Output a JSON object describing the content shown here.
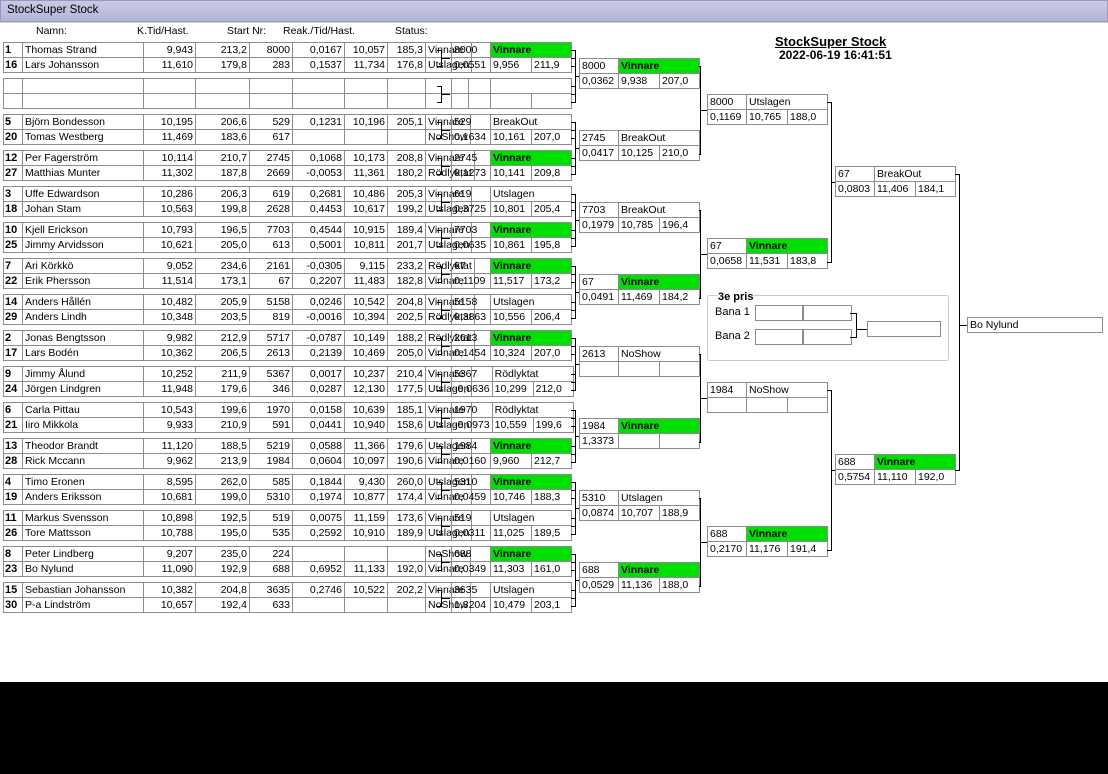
{
  "window": {
    "title": "StockSuper Stock"
  },
  "event": {
    "title": "StockSuper Stock",
    "datetime": "2022-06-19 16:41:51"
  },
  "headers": {
    "name": "Namn:",
    "qualtime": "K.Tid/Hast.",
    "start": "Start Nr:",
    "reak": "Reak./Tid/Hast.",
    "status": "Status:"
  },
  "heats": [
    [
      [
        "1",
        "Thomas Strand",
        "9,943",
        "213,2",
        "8000",
        "0,0167",
        "10,057",
        "185,3",
        "Vinnare"
      ],
      [
        "16",
        "Lars Johansson",
        "11,610",
        "179,8",
        "283",
        "0,1537",
        "11,734",
        "176,8",
        "Utslagen"
      ]
    ],
    [
      [
        "",
        "",
        "",
        "",
        "",
        "",
        "",
        "",
        ""
      ],
      [
        "",
        "",
        "",
        "",
        "",
        "",
        "",
        "",
        ""
      ]
    ],
    [
      [
        "5",
        "Björn Bondesson",
        "10,195",
        "206,6",
        "529",
        "0,1231",
        "10,196",
        "205,1",
        "Vinnare"
      ],
      [
        "20",
        "Tomas Westberg",
        "11,469",
        "183,6",
        "617",
        "",
        "",
        "",
        "NoShow"
      ]
    ],
    [
      [
        "12",
        "Per  Fagerström",
        "10,114",
        "210,7",
        "2745",
        "0,1068",
        "10,173",
        "208,8",
        "Vinnare"
      ],
      [
        "27",
        "Matthias Munter",
        "11,302",
        "187,8",
        "2669",
        "-0,0053",
        "11,361",
        "180,2",
        "Rödlyktat"
      ]
    ],
    [
      [
        "3",
        "Uffe Edwardson",
        "10,286",
        "206,3",
        "619",
        "0,2681",
        "10,486",
        "205,3",
        "Vinnare"
      ],
      [
        "18",
        "Johan Stam",
        "10,563",
        "199,8",
        "2628",
        "0,4453",
        "10,617",
        "199,2",
        "Utslagen"
      ]
    ],
    [
      [
        "10",
        "Kjell Erickson",
        "10,793",
        "196,5",
        "7703",
        "0,4544",
        "10,915",
        "189,4",
        "Vinnare"
      ],
      [
        "25",
        "Jimmy Arvidsson",
        "10,621",
        "205,0",
        "613",
        "0,5001",
        "10,811",
        "201,7",
        "Utslagen"
      ]
    ],
    [
      [
        "7",
        "Ari Körkkö",
        "9,052",
        "234,6",
        "2161",
        "-0,0305",
        "9,115",
        "233,2",
        "Rödlyktat"
      ],
      [
        "22",
        "Erik Phersson",
        "11,514",
        "173,1",
        "67",
        "0,2207",
        "11,483",
        "182,8",
        "Vinnare"
      ]
    ],
    [
      [
        "14",
        "Anders Hållén",
        "10,482",
        "205,9",
        "5158",
        "0,0246",
        "10,542",
        "204,8",
        "Vinnare"
      ],
      [
        "29",
        "Anders Lindh",
        "10,348",
        "203,5",
        "819",
        "-0,0016",
        "10,394",
        "202,5",
        "Rödlyktat"
      ]
    ],
    [
      [
        "2",
        "Jonas Bengtsson",
        "9,982",
        "212,9",
        "5717",
        "-0,0787",
        "10,149",
        "188,2",
        "Rödlyktat"
      ],
      [
        "17",
        "Lars Bodén",
        "10,362",
        "206,5",
        "2613",
        "0,2139",
        "10,469",
        "205,0",
        "Vinnare"
      ]
    ],
    [
      [
        "9",
        "Jimmy Ålund",
        "10,252",
        "211,9",
        "5367",
        "0,0017",
        "10,237",
        "210,4",
        "Vinnare"
      ],
      [
        "24",
        "Jörgen Lindgren",
        "11,948",
        "179,6",
        "346",
        "0,0287",
        "12,130",
        "177,5",
        "Utslagen"
      ]
    ],
    [
      [
        "6",
        "Carla Pittau",
        "10,543",
        "199,6",
        "1970",
        "0,0158",
        "10,639",
        "185,1",
        "Vinnare"
      ],
      [
        "21",
        "Iiro Mikkola",
        "9,933",
        "210,9",
        "591",
        "0,0441",
        "10,940",
        "158,6",
        "Utslagen"
      ]
    ],
    [
      [
        "13",
        "Theodor Brandt",
        "11,120",
        "188,5",
        "5219",
        "0,0588",
        "11,366",
        "179,6",
        "Utslagen"
      ],
      [
        "28",
        "Rick Mccann",
        "9,962",
        "213,9",
        "1984",
        "0,0604",
        "10,097",
        "190,6",
        "Vinnare"
      ]
    ],
    [
      [
        "4",
        "Timo Eronen",
        "8,595",
        "262,0",
        "585",
        "0,1844",
        "9,430",
        "260,0",
        "Utslagen"
      ],
      [
        "19",
        "Anders Eriksson",
        "10,681",
        "199,0",
        "5310",
        "0,1974",
        "10,877",
        "174,4",
        "Vinnare"
      ]
    ],
    [
      [
        "11",
        "Markus Svensson",
        "10,898",
        "192,5",
        "519",
        "0,0075",
        "11,159",
        "173,6",
        "Vinnare"
      ],
      [
        "26",
        "Tore Mattsson",
        "10,788",
        "195,0",
        "535",
        "0,2592",
        "10,910",
        "189,9",
        "Utslagen"
      ]
    ],
    [
      [
        "8",
        "Peter Lindberg",
        "9,207",
        "235,0",
        "224",
        "",
        "",
        "",
        "NoShow"
      ],
      [
        "23",
        "Bo Nylund",
        "11,090",
        "192,9",
        "688",
        "0,6952",
        "11,133",
        "192,0",
        "Vinnare"
      ]
    ],
    [
      [
        "15",
        "Sebastian Johansson",
        "10,382",
        "204,8",
        "3635",
        "0,2746",
        "10,522",
        "202,2",
        "Vinnare"
      ],
      [
        "30",
        "P-a Lindström",
        "10,657",
        "192,4",
        "633",
        "",
        "",
        "",
        "NoShow"
      ]
    ]
  ],
  "round2": [
    [
      [
        "8000",
        "Vinnare",
        ""
      ],
      [
        "0,0551",
        "9,956",
        "211,9"
      ]
    ],
    [
      [
        "",
        "",
        " "
      ],
      [
        "",
        "",
        ""
      ]
    ],
    [
      [
        "529",
        "BreakOut",
        ""
      ],
      [
        "0,1634",
        "10,161",
        "207,0"
      ]
    ],
    [
      [
        "2745",
        "Vinnare",
        ""
      ],
      [
        "0,1273",
        "10,141",
        "209,8"
      ]
    ],
    [
      [
        "619",
        "Utslagen",
        ""
      ],
      [
        "0,3725",
        "10,801",
        "205,4"
      ]
    ],
    [
      [
        "7703",
        "Vinnare",
        ""
      ],
      [
        "0,0635",
        "10,861",
        "195,8"
      ]
    ],
    [
      [
        "67",
        "Vinnare",
        ""
      ],
      [
        "0,1109",
        "11,517",
        "173,2"
      ]
    ],
    [
      [
        "5158",
        "Utslagen",
        ""
      ],
      [
        "0,3863",
        "10,556",
        "206,4"
      ]
    ],
    [
      [
        "2613",
        "Vinnare",
        ""
      ],
      [
        "0,1454",
        "10,324",
        "207,0"
      ]
    ],
    [
      [
        "5367",
        "Rödlyktat",
        ""
      ],
      [
        "-0,0636",
        "10,299",
        "212,0"
      ]
    ],
    [
      [
        "1970",
        "Rödlyktat",
        ""
      ],
      [
        "-0,0973",
        "10,559",
        "199,6"
      ]
    ],
    [
      [
        "1984",
        "Vinnare",
        ""
      ],
      [
        "0,0160",
        "9,960",
        "212,7"
      ]
    ],
    [
      [
        "5310",
        "Vinnare",
        ""
      ],
      [
        "0,0459",
        "10,746",
        "188,3"
      ]
    ],
    [
      [
        "519",
        "Utslagen",
        ""
      ],
      [
        "0,0311",
        "11,025",
        "189,5"
      ]
    ],
    [
      [
        "688",
        "Vinnare",
        ""
      ],
      [
        "0,0349",
        "11,303",
        "161,0"
      ]
    ],
    [
      [
        "3635",
        "Utslagen",
        ""
      ],
      [
        "1,3204",
        "10,479",
        "203,1"
      ]
    ]
  ],
  "round3": [
    [
      [
        "8000",
        "Vinnare",
        ""
      ],
      [
        "0,0362",
        "9,938",
        "207,0"
      ]
    ],
    [
      [
        "2745",
        "BreakOut",
        ""
      ],
      [
        "0,0417",
        "10,125",
        "210,0"
      ]
    ],
    [
      [
        "7703",
        "BreakOut",
        ""
      ],
      [
        "0,1979",
        "10,785",
        "196,4"
      ]
    ],
    [
      [
        "67",
        "Vinnare",
        ""
      ],
      [
        "0,0491",
        "11,469",
        "184,2"
      ]
    ],
    [
      [
        "2613",
        "NoShow",
        ""
      ],
      [
        "",
        "",
        ""
      ]
    ],
    [
      [
        "1984",
        "Vinnare",
        ""
      ],
      [
        "1,3373",
        "",
        ""
      ]
    ],
    [
      [
        "5310",
        "Utslagen",
        ""
      ],
      [
        "0,0874",
        "10,707",
        "188,9"
      ]
    ],
    [
      [
        "688",
        "Vinnare",
        ""
      ],
      [
        "0,0529",
        "11,136",
        "188,0"
      ]
    ]
  ],
  "round4": [
    [
      [
        "8000",
        "Utslagen",
        ""
      ],
      [
        "0,1169",
        "10,765",
        "188,0"
      ]
    ],
    [
      [
        "67",
        "Vinnare",
        ""
      ],
      [
        "0,0658",
        "11,531",
        "183,8"
      ]
    ],
    [
      [
        "1984",
        "NoShow",
        ""
      ],
      [
        "",
        "",
        ""
      ]
    ],
    [
      [
        "688",
        "Vinnare",
        ""
      ],
      [
        "0,2170",
        "11,176",
        "191,4"
      ]
    ]
  ],
  "round5": [
    [
      [
        "67",
        "BreakOut",
        ""
      ],
      [
        "0,0803",
        "11,406",
        "184,1"
      ]
    ],
    [
      [
        "688",
        "Vinnare",
        ""
      ],
      [
        "0,5754",
        "11,110",
        "192,0"
      ]
    ]
  ],
  "third_place": {
    "label": "3e pris",
    "lane1": "Bana 1",
    "lane2": "Bana 2"
  },
  "champion": "Bo Nylund",
  "colors": {
    "winner": "#00e000",
    "titlebar": "#c2c2e2"
  }
}
